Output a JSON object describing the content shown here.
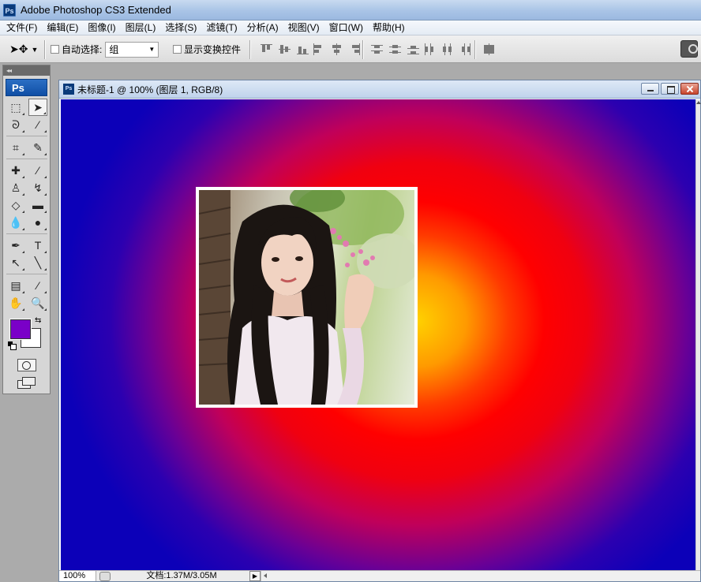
{
  "app": {
    "title": "Adobe Photoshop CS3 Extended",
    "icon_label": "Ps"
  },
  "menu": [
    "文件(F)",
    "编辑(E)",
    "图像(I)",
    "图层(L)",
    "选择(S)",
    "滤镜(T)",
    "分析(A)",
    "视图(V)",
    "窗口(W)",
    "帮助(H)"
  ],
  "options": {
    "auto_select_label": "自动选择:",
    "auto_select_checked": false,
    "auto_select_value": "组",
    "show_transform_label": "显示变换控件",
    "show_transform_checked": false
  },
  "toolbox": {
    "logo": "Ps",
    "foreground_color": "#7a00c8",
    "background_color": "#ffffff",
    "tools": [
      "marquee-tool",
      "move-tool",
      "lasso-tool",
      "magic-wand-tool",
      "crop-tool",
      "slice-tool",
      "healing-brush-tool",
      "brush-tool",
      "clone-stamp-tool",
      "history-brush-tool",
      "eraser-tool",
      "gradient-tool",
      "blur-tool",
      "dodge-tool",
      "pen-tool",
      "type-tool",
      "path-selection-tool",
      "line-tool",
      "notes-tool",
      "eyedropper-tool",
      "hand-tool",
      "zoom-tool"
    ]
  },
  "document": {
    "title": "未标题-1 @ 100% (图层 1, RGB/8)",
    "icon_label": "Ps",
    "zoom": "100%",
    "doc_info": "文档:1.37M/3.05M"
  },
  "colors": {
    "gradient_center": "#ffd200",
    "gradient_mid": "#ff0000",
    "gradient_edge": "#0c00b8"
  }
}
